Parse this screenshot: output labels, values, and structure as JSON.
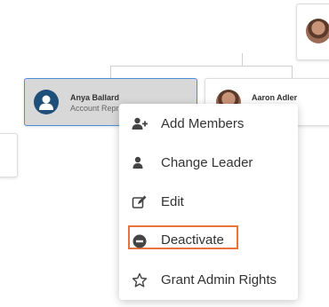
{
  "org_chart": {
    "nodes": [
      {
        "name": "Anya Ballard",
        "title": "Account Repr",
        "selected": true,
        "avatar": "user-silhouette-icon"
      },
      {
        "name": "Aaron Adler",
        "title": "",
        "selected": false,
        "avatar": "photo"
      }
    ]
  },
  "context_menu": {
    "items": [
      {
        "label": "Add Members",
        "icon": "add-user-icon"
      },
      {
        "label": "Change Leader",
        "icon": "user-icon"
      },
      {
        "label": "Edit",
        "icon": "edit-icon"
      },
      {
        "label": "Deactivate",
        "icon": "minus-circle-icon",
        "highlighted": true
      },
      {
        "label": "Grant Admin Rights",
        "icon": "star-outline-icon"
      }
    ]
  },
  "colors": {
    "highlight_outline": "#e8743b",
    "selected_border": "#4a90d9",
    "selected_bg": "#d8d8d8",
    "avatar_generic_bg": "#1f4e79"
  }
}
